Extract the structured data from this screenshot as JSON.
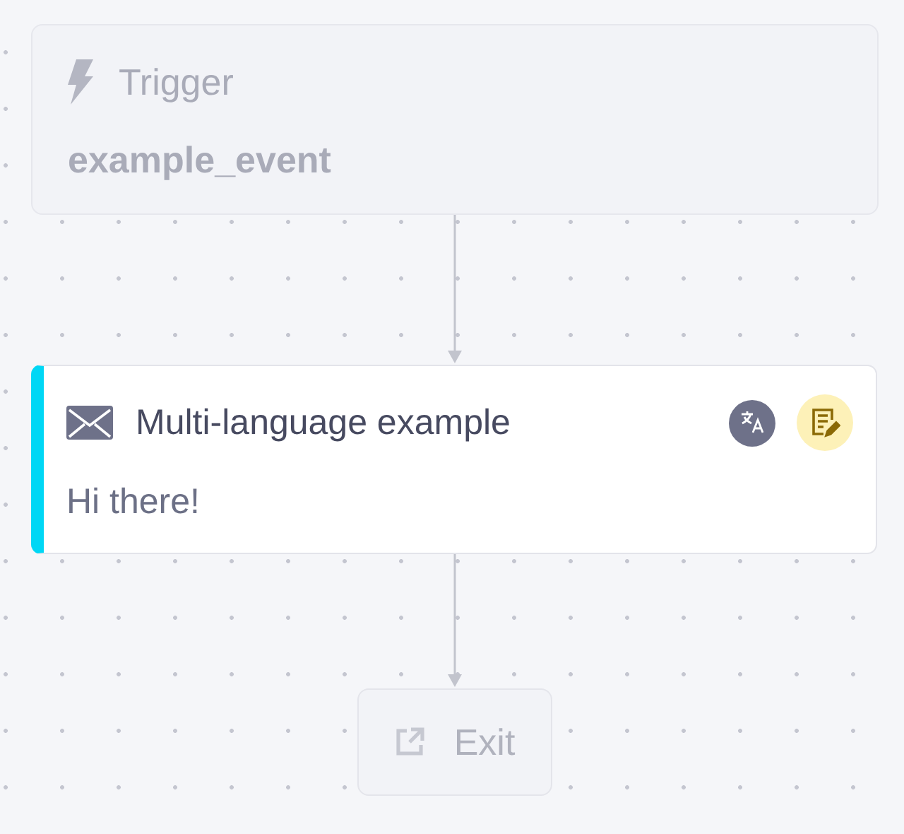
{
  "trigger": {
    "label": "Trigger",
    "event": "example_event"
  },
  "message": {
    "title": "Multi-language example",
    "body": "Hi there!"
  },
  "exit": {
    "label": "Exit"
  }
}
